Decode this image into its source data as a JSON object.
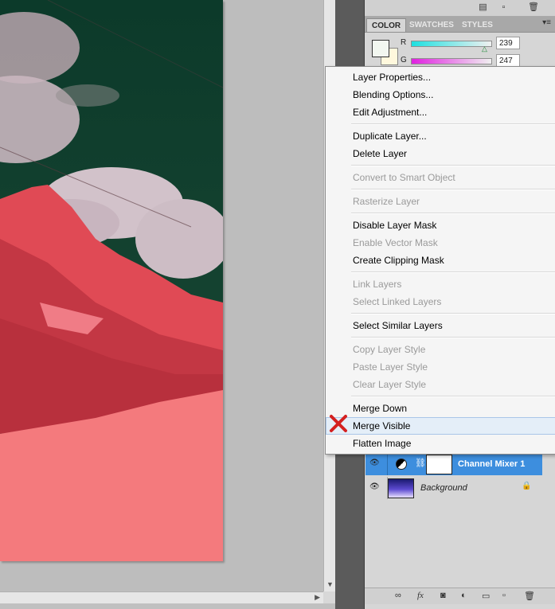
{
  "color_panel": {
    "tabs": [
      "COLOR",
      "SWATCHES",
      "STYLES"
    ],
    "r_label": "R",
    "g_label": "G",
    "r_value": "239",
    "g_value": "247"
  },
  "context_menu": {
    "items": [
      {
        "label": "Layer Properties...",
        "enabled": true
      },
      {
        "label": "Blending Options...",
        "enabled": true
      },
      {
        "label": "Edit Adjustment...",
        "enabled": true
      },
      {
        "label": "Duplicate Layer...",
        "enabled": true
      },
      {
        "label": "Delete Layer",
        "enabled": true
      },
      {
        "label": "Convert to Smart Object",
        "enabled": false
      },
      {
        "label": "Rasterize Layer",
        "enabled": false
      },
      {
        "label": "Disable Layer Mask",
        "enabled": true
      },
      {
        "label": "Enable Vector Mask",
        "enabled": false
      },
      {
        "label": "Create Clipping Mask",
        "enabled": true
      },
      {
        "label": "Link Layers",
        "enabled": false
      },
      {
        "label": "Select Linked Layers",
        "enabled": false
      },
      {
        "label": "Select Similar Layers",
        "enabled": true
      },
      {
        "label": "Copy Layer Style",
        "enabled": false
      },
      {
        "label": "Paste Layer Style",
        "enabled": false
      },
      {
        "label": "Clear Layer Style",
        "enabled": false
      },
      {
        "label": "Merge Down",
        "enabled": true
      },
      {
        "label": "Merge Visible",
        "enabled": true,
        "highlighted": true
      },
      {
        "label": "Flatten Image",
        "enabled": true
      }
    ]
  },
  "layers": {
    "rows": [
      {
        "name": "Channel Mixer 1",
        "selected": true
      },
      {
        "name": "Background",
        "selected": false,
        "locked": true
      }
    ]
  },
  "icons": {
    "eye": "eye-icon",
    "lock": "lock-icon",
    "link": "link-icon",
    "fx": "fx-icon",
    "mask": "mask-icon",
    "adjustment": "adjustment-icon",
    "folder": "folder-icon",
    "new_layer": "new-layer-icon",
    "trash": "trash-icon"
  },
  "colors": {
    "selection": "#3d8ede",
    "marker": "#d42020",
    "photo_sky": "#0f3d2c",
    "photo_snow": "#f47a7d"
  }
}
